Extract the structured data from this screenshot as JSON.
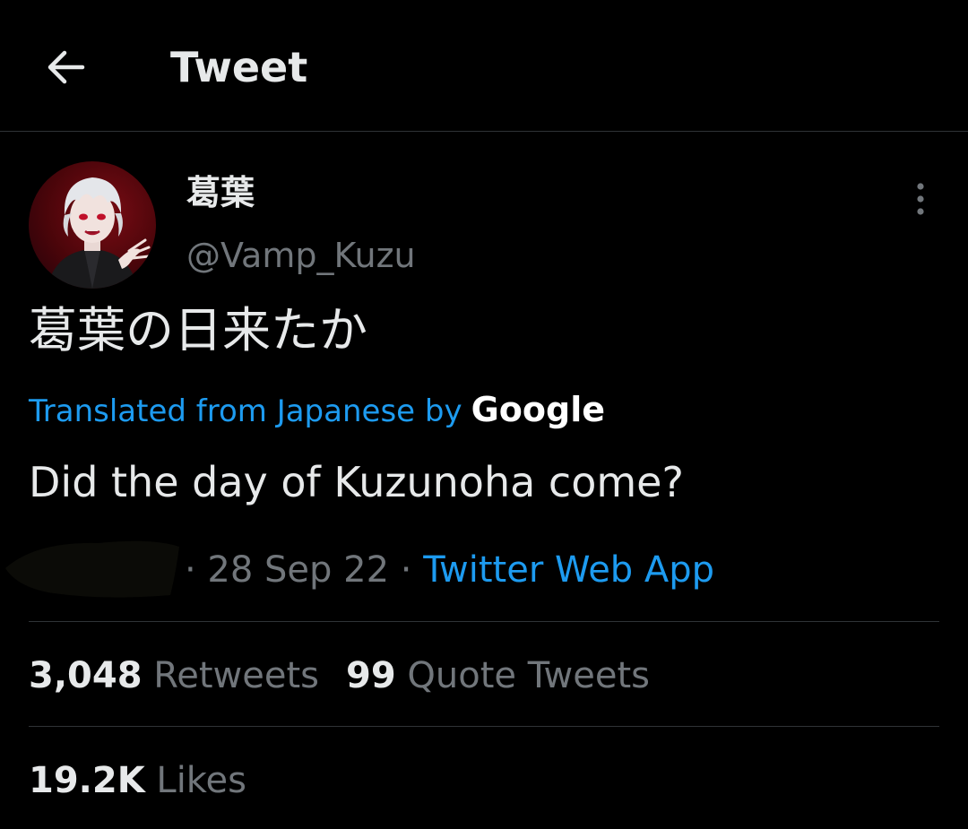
{
  "header": {
    "back_icon": "arrow-left-icon",
    "title": "Tweet"
  },
  "tweet": {
    "author": {
      "display_name": "葛葉",
      "handle": "@Vamp_Kuzu",
      "more_icon": "more-vertical-icon"
    },
    "text": "葛葉の日来たか",
    "translation": {
      "attribution": "Translated from Japanese by",
      "provider": "Google",
      "text": "Did the day of Kuzunoha come?"
    },
    "date": "· 28 Sep 22 ·",
    "source": "Twitter Web App"
  },
  "stats": {
    "retweets_count": "3,048",
    "retweets_label": "Retweets",
    "quotes_count": "99",
    "quotes_label": "Quote Tweets",
    "likes_count": "19.2K",
    "likes_label": "Likes"
  },
  "colors": {
    "background": "#000000",
    "text_primary": "#e7e9ea",
    "text_secondary": "#71767b",
    "accent": "#1d9bf0",
    "divider": "#2f3336"
  }
}
